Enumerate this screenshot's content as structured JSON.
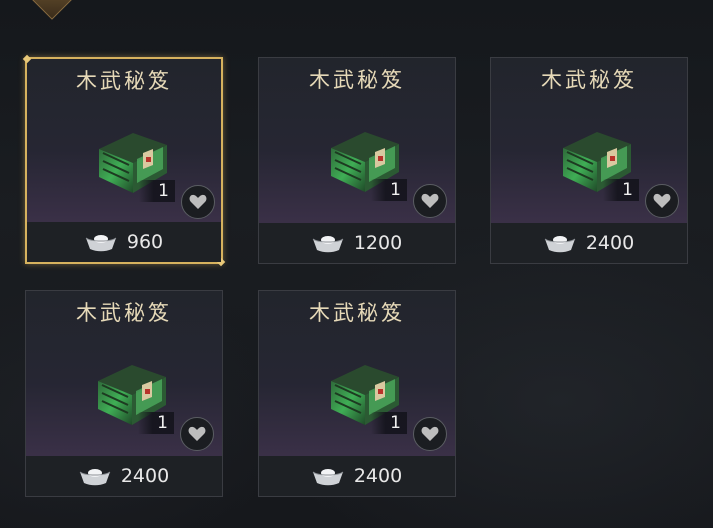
{
  "colors": {
    "selected_border": "#d6b25e",
    "item_name": "#e6d9b8",
    "price_text": "#e8e8e8"
  },
  "shop": {
    "items": [
      {
        "name": "木武秘笈",
        "quantity": "1",
        "price": "960",
        "selected": true,
        "currency_icon": "silver-ingot-icon",
        "favorite_icon": "heart-icon"
      },
      {
        "name": "木武秘笈",
        "quantity": "1",
        "price": "1200",
        "selected": false,
        "currency_icon": "silver-ingot-icon",
        "favorite_icon": "heart-icon"
      },
      {
        "name": "木武秘笈",
        "quantity": "1",
        "price": "2400",
        "selected": false,
        "currency_icon": "silver-ingot-icon",
        "favorite_icon": "heart-icon"
      },
      {
        "name": "木武秘笈",
        "quantity": "1",
        "price": "2400",
        "selected": false,
        "currency_icon": "silver-ingot-icon",
        "favorite_icon": "heart-icon"
      },
      {
        "name": "木武秘笈",
        "quantity": "1",
        "price": "2400",
        "selected": false,
        "currency_icon": "silver-ingot-icon",
        "favorite_icon": "heart-icon"
      }
    ]
  }
}
